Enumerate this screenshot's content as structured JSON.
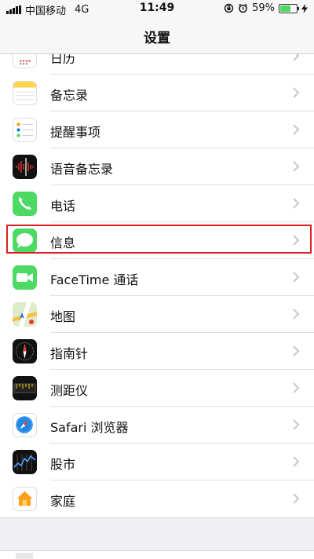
{
  "status_bar": {
    "carrier": "中国移动",
    "network": "4G",
    "time": "11:49",
    "battery": "59%",
    "battery_level": 0.59
  },
  "nav": {
    "title": "设置"
  },
  "rows": [
    {
      "label": "日历"
    },
    {
      "label": "备忘录"
    },
    {
      "label": "提醒事项"
    },
    {
      "label": "语音备忘录"
    },
    {
      "label": "电话"
    },
    {
      "label": "信息"
    },
    {
      "label": "FaceTime 通话"
    },
    {
      "label": "地图"
    },
    {
      "label": "指南针"
    },
    {
      "label": "测距仪"
    },
    {
      "label": "Safari 浏览器"
    },
    {
      "label": "股市"
    },
    {
      "label": "家庭"
    }
  ],
  "colors": {
    "highlight": "#e02020",
    "phone": "#4cd964",
    "messages": "#4cd964",
    "facetime": "#4cd964",
    "safari": "#1e88e5",
    "notes": "#ffd54a"
  }
}
